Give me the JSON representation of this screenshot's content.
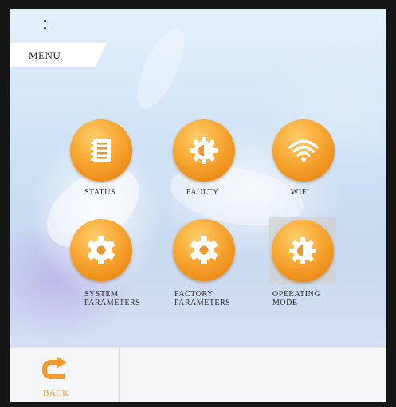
{
  "header": {
    "title": "MENU"
  },
  "menu_items": [
    {
      "label": "STATUS",
      "icon": "notebook-icon"
    },
    {
      "label": "FAULTY",
      "icon": "half-gear-icon"
    },
    {
      "label": "WIFI",
      "icon": "wifi-icon"
    },
    {
      "label_line1": "SYSTEM",
      "label_line2": "PARAMETERS",
      "icon": "gear-icon"
    },
    {
      "label_line1": "FACTORY",
      "label_line2": "PARAMETERS",
      "icon": "gear-icon"
    },
    {
      "label_line1": "OPERATING",
      "label_line2": "MODE",
      "icon": "half-gear-icon"
    }
  ],
  "footer": {
    "back_label": "BACK",
    "back_icon": "back-arrow-icon"
  },
  "colors": {
    "accent": "#f39a2a",
    "icon_orange": "#f7a632",
    "frame": "#161616"
  }
}
